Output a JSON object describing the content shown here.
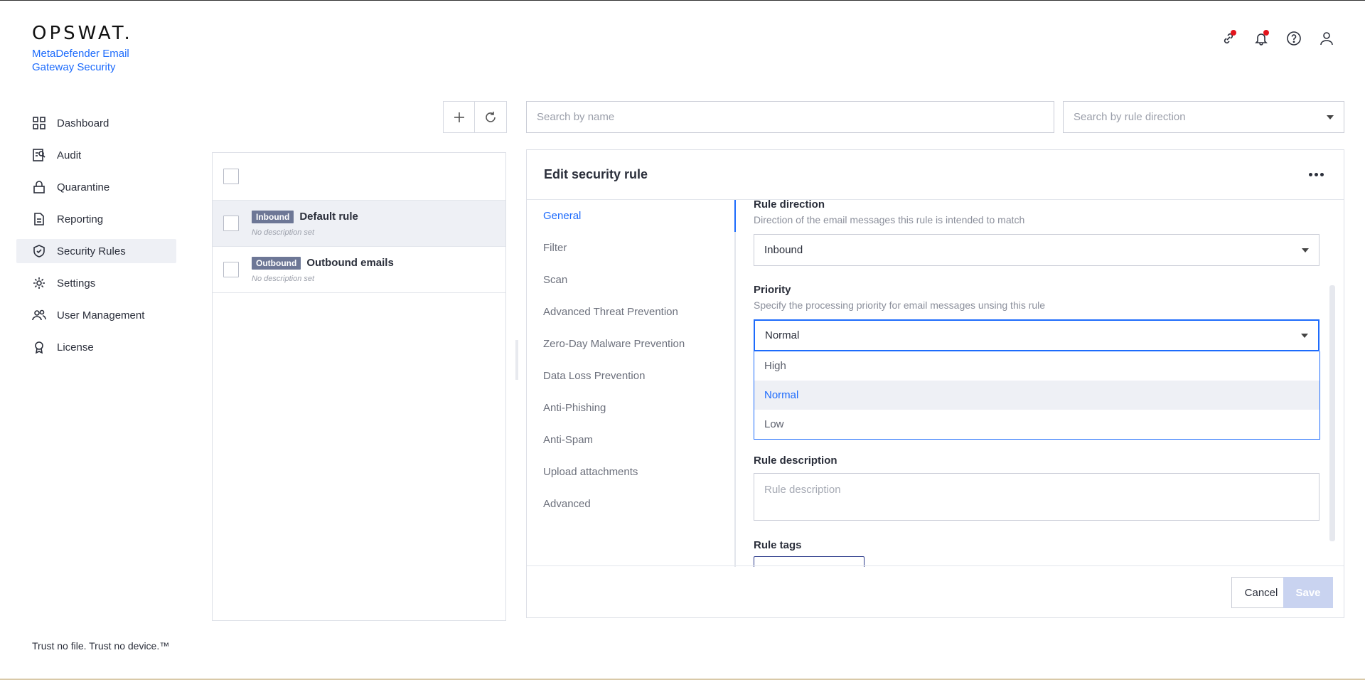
{
  "brand": {
    "logo": "OPSWAT.",
    "product": "MetaDefender Email Gateway Security"
  },
  "sidebar": {
    "items": [
      {
        "label": "Dashboard",
        "icon": "dashboard-icon"
      },
      {
        "label": "Audit",
        "icon": "audit-icon"
      },
      {
        "label": "Quarantine",
        "icon": "lock-icon"
      },
      {
        "label": "Reporting",
        "icon": "report-icon"
      },
      {
        "label": "Security Rules",
        "icon": "shield-check-icon",
        "active": true
      },
      {
        "label": "Settings",
        "icon": "gear-icon"
      },
      {
        "label": "User Management",
        "icon": "users-icon"
      },
      {
        "label": "License",
        "icon": "award-icon"
      }
    ]
  },
  "tagline": "Trust no file. Trust no device.™",
  "header": {
    "icons": [
      "link-icon",
      "bell-icon",
      "help-icon",
      "user-icon"
    ],
    "notification_color": "#e3151d"
  },
  "toolbar": {
    "search_name_placeholder": "Search by name",
    "search_direction_placeholder": "Search by rule direction"
  },
  "rules": [
    {
      "badge": "Inbound",
      "name": "Default rule",
      "description": "No description set",
      "selected": true
    },
    {
      "badge": "Outbound",
      "name": "Outbound emails",
      "description": "No description set",
      "selected": false
    }
  ],
  "edit": {
    "title": "Edit security rule",
    "tabs": [
      "General",
      "Filter",
      "Scan",
      "Advanced Threat Prevention",
      "Zero-Day Malware Prevention",
      "Data Loss Prevention",
      "Anti-Phishing",
      "Anti-Spam",
      "Upload attachments",
      "Advanced"
    ],
    "active_tab": "General",
    "rule_direction": {
      "label": "Rule direction",
      "help": "Direction of the email messages this rule is intended to match",
      "value": "Inbound"
    },
    "priority": {
      "label": "Priority",
      "help": "Specify the processing priority for email messages unsing this rule",
      "value": "Normal",
      "options": [
        "High",
        "Normal",
        "Low"
      ],
      "selected": "Normal"
    },
    "rule_description": {
      "label": "Rule description",
      "placeholder": "Rule description"
    },
    "rule_tags": {
      "label": "Rule tags"
    },
    "cancel_label": "Cancel",
    "save_label": "Save"
  },
  "colors": {
    "accent": "#1d6bfc",
    "badge": "#6d7796",
    "save_disabled": "#c9d3f0"
  }
}
